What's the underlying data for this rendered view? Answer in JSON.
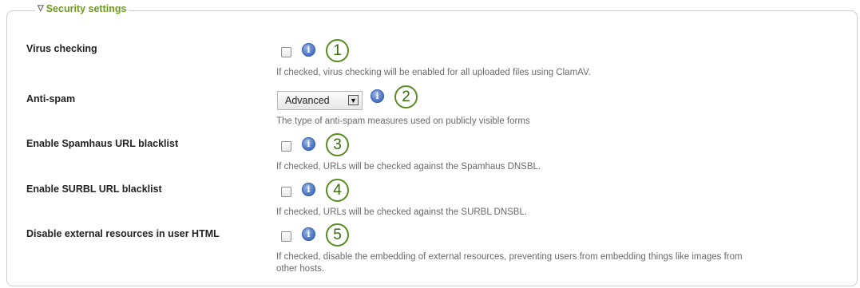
{
  "section": {
    "title": "Security settings",
    "collapse_icon": "triangle-down-icon"
  },
  "settings": [
    {
      "label": "Virus checking",
      "control": "checkbox",
      "checked": false,
      "description": "If checked, virus checking will be enabled for all uploaded files using ClamAV.",
      "callout": "1"
    },
    {
      "label": "Anti-spam",
      "control": "select",
      "value": "Advanced",
      "description": "The type of anti-spam measures used on publicly visible forms",
      "callout": "2"
    },
    {
      "label": "Enable Spamhaus URL blacklist",
      "control": "checkbox",
      "checked": false,
      "description": "If checked, URLs will be checked against the Spamhaus DNSBL.",
      "callout": "3"
    },
    {
      "label": "Enable SURBL URL blacklist",
      "control": "checkbox",
      "checked": false,
      "description": "If checked, URLs will be checked against the SURBL DNSBL.",
      "callout": "4"
    },
    {
      "label": "Disable external resources in user HTML",
      "control": "checkbox",
      "checked": false,
      "description_line1": "If checked, disable the embedding of external resources, preventing users from embedding things like images from",
      "description_line2": "other hosts.",
      "callout": "5"
    }
  ],
  "icons": {
    "info": "info-icon"
  },
  "colors": {
    "legend": "#6b9a1f",
    "callout_border": "#5b8c22",
    "info_blue": "#4f79c4"
  }
}
